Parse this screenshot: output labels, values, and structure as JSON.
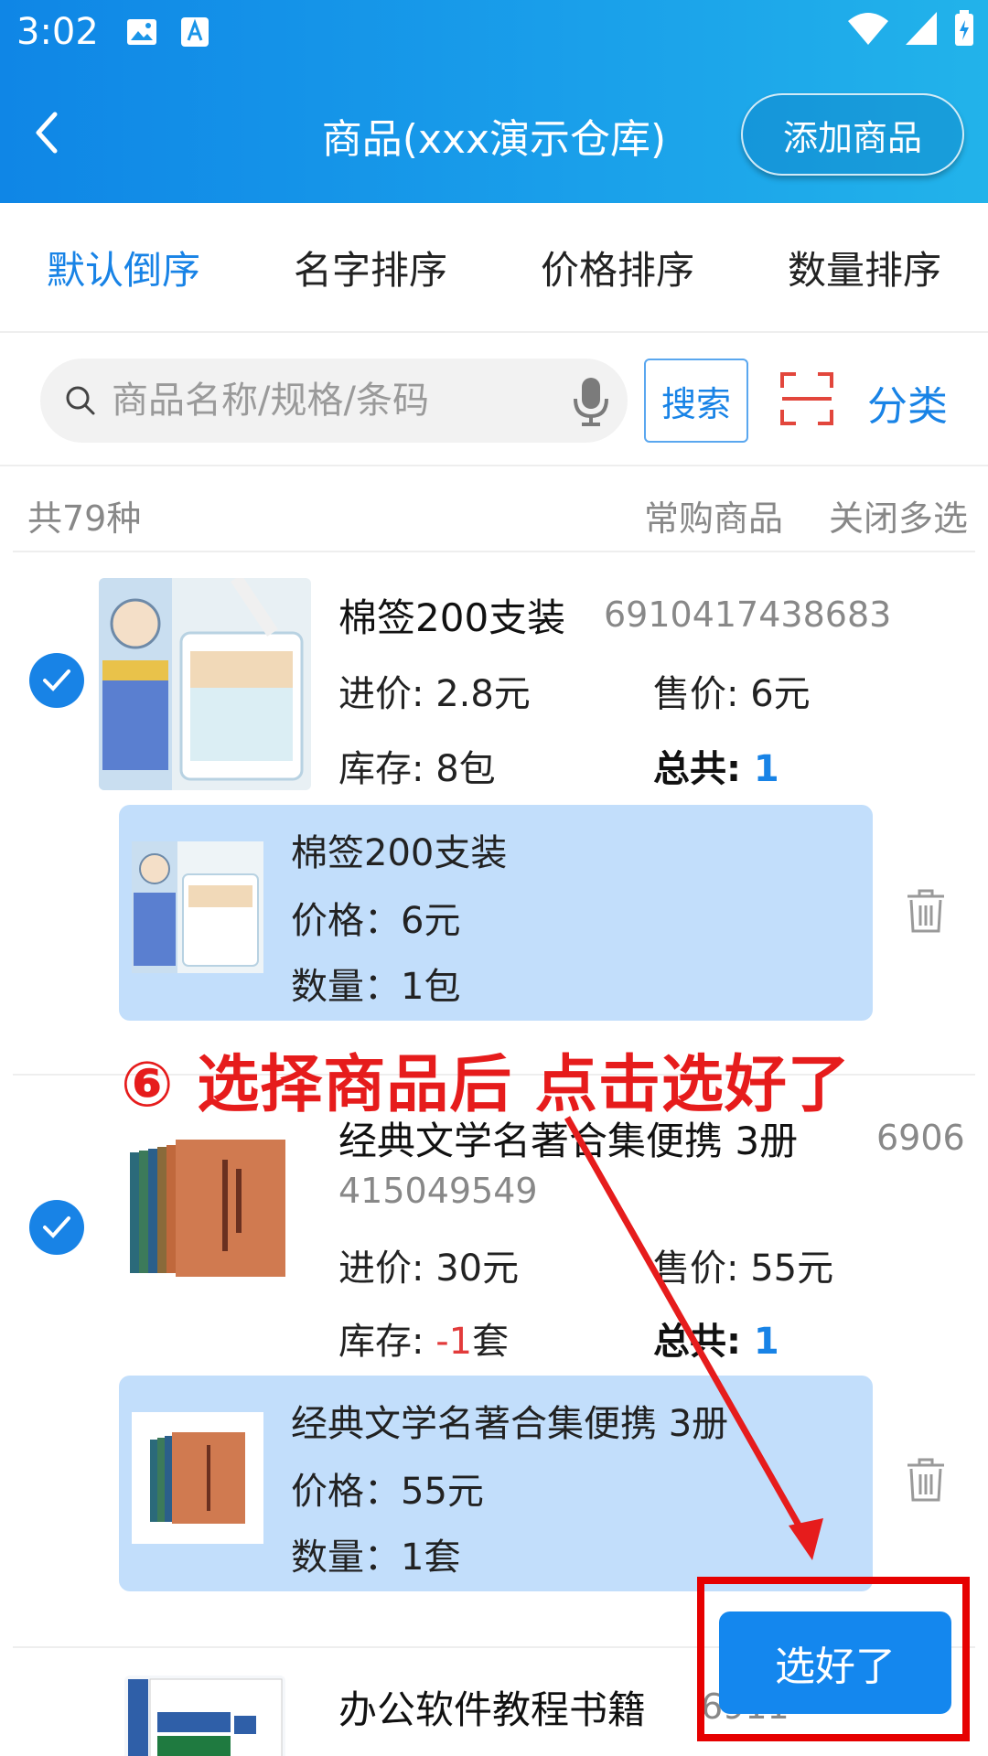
{
  "status_bar": {
    "time": "3:02"
  },
  "header": {
    "title": "商品(xxx演示仓库)",
    "add_button": "添加商品"
  },
  "sort_tabs": [
    "默认倒序",
    "名字排序",
    "价格排序",
    "数量排序"
  ],
  "search": {
    "placeholder": "商品名称/规格/条码",
    "button": "搜索",
    "category": "分类"
  },
  "summary": {
    "count": "共79种",
    "frequent": "常购商品",
    "close_multi": "关闭多选"
  },
  "products": [
    {
      "name": "棉签200支装",
      "barcode": "6910417438683",
      "cost": "进价: 2.8元",
      "price": "售价: 6元",
      "stock_label": "库存: ",
      "stock_value": "8",
      "stock_unit": "包",
      "total_label": "总共: ",
      "total_value": "1",
      "cart": {
        "name": "棉签200支装",
        "price": "价格：6元",
        "qty": "数量：1包"
      }
    },
    {
      "name": "经典文学名著合集便携  3册",
      "barcode_a": "6906",
      "barcode_b": "415049549",
      "cost": "进价: 30元",
      "price": "售价: 55元",
      "stock_label": "库存: ",
      "stock_value": "-1",
      "stock_unit": "套",
      "total_label": "总共: ",
      "total_value": "1",
      "cart": {
        "name": "经典文学名著合集便携 3册",
        "price": "价格：55元",
        "qty": "数量：1套"
      }
    },
    {
      "name": "办公软件教程书籍",
      "barcode": "6911"
    }
  ],
  "annotation": "⑥ 选择商品后 点击选好了",
  "done_button": "选好了",
  "colors": {
    "accent": "#1883e6",
    "annotation": "#e61c1c",
    "cart_bg": "#c2defb"
  }
}
